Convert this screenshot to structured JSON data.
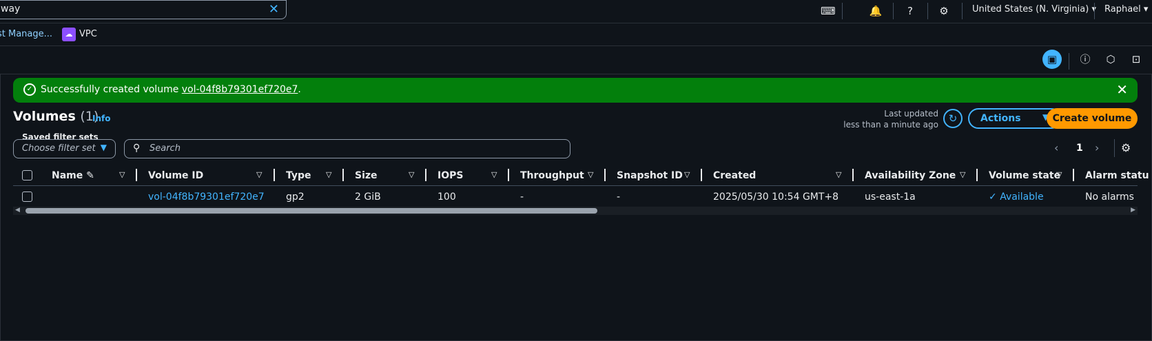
{
  "topbar": {
    "search_value": "way",
    "region": "United States (N. Virginia)",
    "user": "Raphael"
  },
  "favorites": {
    "item1": "st Manage...",
    "item2": "VPC"
  },
  "flash": {
    "prefix": "Successfully created volume ",
    "volume_link": "vol-04f8b79301ef720e7",
    "suffix": "."
  },
  "header": {
    "title": "Volumes",
    "count": "(1)",
    "info": "Info",
    "last_updated_label": "Last updated",
    "last_updated_value": "less than a minute ago",
    "actions_label": "Actions",
    "create_label": "Create volume"
  },
  "filters": {
    "saved_label": "Saved filter sets",
    "saved_placeholder": "Choose filter set",
    "search_placeholder": "Search"
  },
  "pagination": {
    "current_page": "1"
  },
  "table": {
    "columns": [
      "Name",
      "Volume ID",
      "Type",
      "Size",
      "IOPS",
      "Throughput",
      "Snapshot ID",
      "Created",
      "Availability Zone",
      "Volume state",
      "Alarm statu"
    ],
    "rows": [
      {
        "name": "",
        "volume_id": "vol-04f8b79301ef720e7",
        "type": "gp2",
        "size": "2 GiB",
        "iops": "100",
        "throughput": "-",
        "snapshot_id": "-",
        "created": "2025/05/30 10:54 GMT+8",
        "az": "us-east-1a",
        "state": "Available",
        "alarm": "No alarms"
      }
    ]
  },
  "colors": {
    "accent": "#42b4ff",
    "success": "#037f0c",
    "primary_button": "#ff9900",
    "background": "#0f141a"
  }
}
